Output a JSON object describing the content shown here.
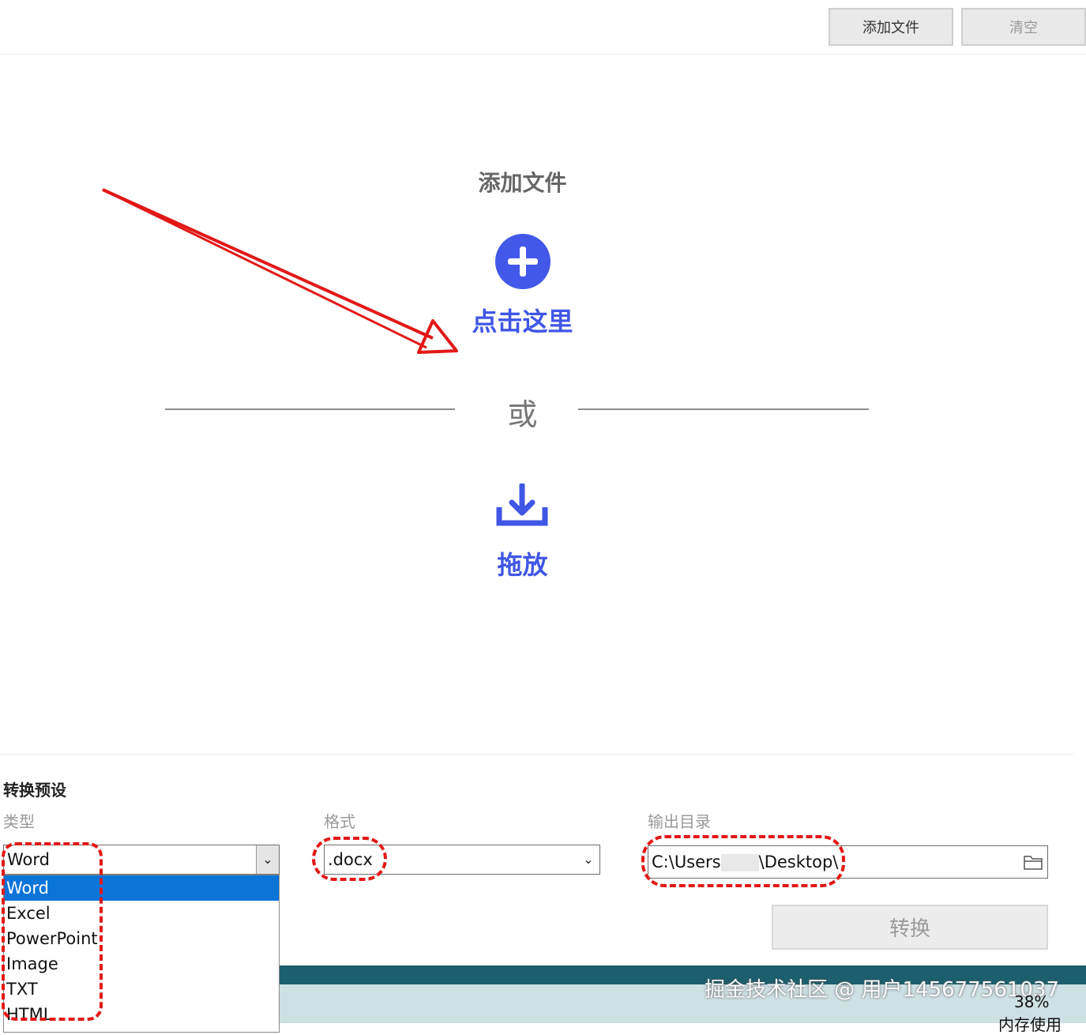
{
  "toolbar": {
    "add_file_label": "添加文件",
    "clear_label": "清空"
  },
  "drop_zone": {
    "title": "添加文件",
    "click_here": "点击这里",
    "or_text": "或",
    "drag_drop": "拖放"
  },
  "preset": {
    "section_title": "转换预设",
    "type_label": "类型",
    "type_value": "Word",
    "type_options": [
      "Word",
      "Excel",
      "PowerPoint",
      "Image",
      "TXT",
      "HTML"
    ],
    "format_label": "格式",
    "format_value": ".docx",
    "output_label": "输出目录",
    "output_value_prefix": "C:\\Users",
    "output_value_suffix": "\\Desktop\\",
    "convert_label": "转换"
  },
  "taskbar": {
    "watermark": "掘金技术社区 @ 用户145677561037",
    "percent": "38%",
    "memory_label": "内存使用"
  },
  "colors": {
    "accent": "#4358e8",
    "selection": "#0a74d8",
    "annotation": "#e21818"
  }
}
